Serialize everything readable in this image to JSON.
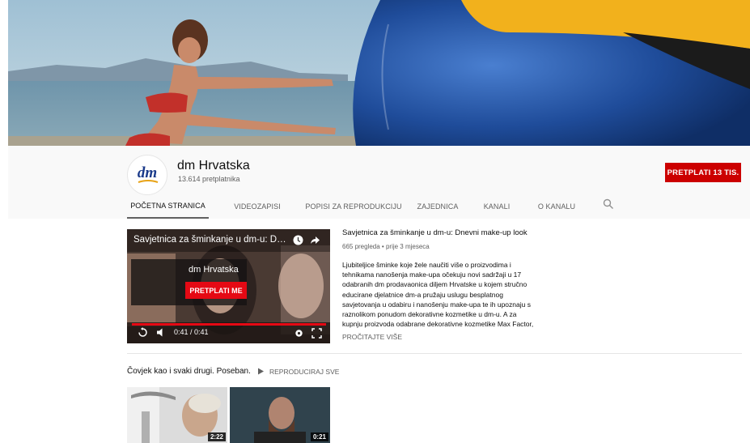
{
  "channel": {
    "avatar_text": "dm",
    "name": "dm Hrvatska",
    "subscribers": "13.614 pretplatnika",
    "subscribe_label": "PRETPLATI  13 TIS."
  },
  "tabs": [
    {
      "label": "POČETNA STRANICA",
      "active": true
    },
    {
      "label": "VIDEOZAPISI",
      "active": false
    },
    {
      "label": "POPISI ZA REPRODUKCIJU",
      "active": false
    },
    {
      "label": "ZAJEDNICA",
      "active": false
    },
    {
      "label": "KANALI",
      "active": false
    },
    {
      "label": "O KANALU",
      "active": false
    }
  ],
  "featured": {
    "player_title": "Savjetnica za šminkanje u dm-u: Dnevn...",
    "endcard_channel": "dm Hrvatska",
    "endcard_button": "PRETPLATI ME",
    "time": "0:41 / 0:41",
    "progress": 1.0,
    "title": "Savjetnica za šminkanje u dm-u: Dnevni make-up look",
    "meta": "665 pregleda • prije 3 mjeseca",
    "description_lines": [
      "Ljubiteljice šminke koje žele naučiti više o proizvodima i",
      "tehnikama nanošenja make-upa očekuju novi sadržaji u 17",
      "odabranih dm prodavaonica diljem Hrvatske u kojem stručno",
      "educirane djelatnice dm-a pružaju uslugu besplatnog",
      "savjetovanja u odabiru i nanošenju make-upa te ih upoznaju s",
      "raznolikom ponudom dekorativne kozmetike u dm-u. A za",
      "kupnju proizvoda odabrane dekorativne kozmetike Max Factor,"
    ],
    "read_more": "PROČITAJTE VIŠE"
  },
  "shelf": {
    "title": "Čovjek kao i svaki drugi. Poseban.",
    "play_all": "REPRODUCIRAJ SVE",
    "videos": [
      {
        "duration": "2:22"
      },
      {
        "duration": "0:21"
      }
    ]
  },
  "colors": {
    "subscribe": "#cc0000",
    "endcard_button": "#e50914",
    "brand_blue": "#1a3a8a"
  },
  "icons": [
    "search-icon",
    "watch-later-icon",
    "share-icon",
    "replay-icon",
    "volume-icon",
    "settings-icon",
    "fullscreen-icon",
    "play-all-icon"
  ]
}
